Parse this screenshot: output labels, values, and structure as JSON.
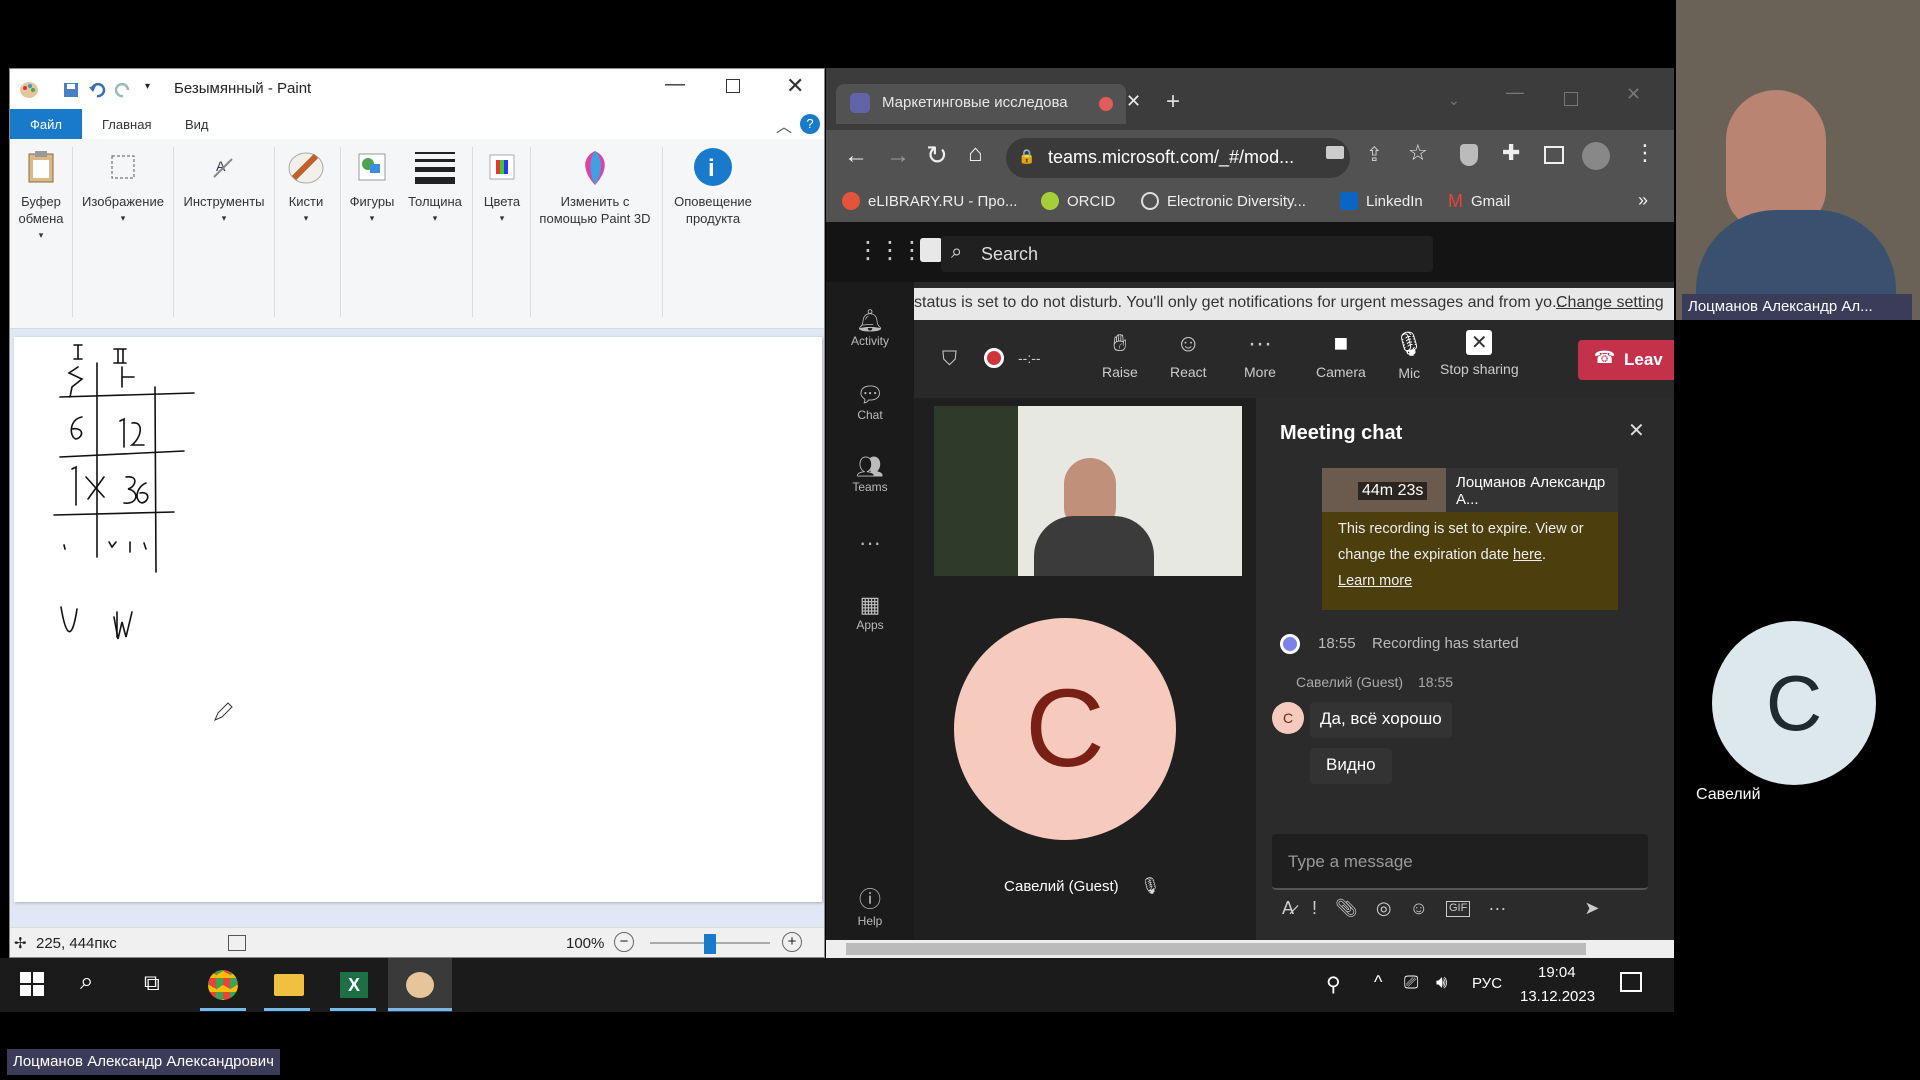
{
  "paint": {
    "title": "Безымянный - Paint",
    "menu": {
      "file": "Файл",
      "home": "Главная",
      "view": "Вид"
    },
    "ribbon": {
      "clipboard": "Буфер обмена",
      "image": "Изображение",
      "tools": "Инструменты",
      "brushes": "Кисти",
      "shapes": "Фигуры",
      "thickness": "Толщина",
      "colors": "Цвета",
      "paint3d": "Изменить с помощью Paint 3D",
      "notification": "Оповещение продукта"
    },
    "status": {
      "coords": "225, 444пкс",
      "zoom": "100%"
    },
    "zoom_level": 0.5
  },
  "browser": {
    "tab_title": "Маркетинговые исследова",
    "url": "teams.microsoft.com/_#/mod...",
    "bookmarks": [
      "eLIBRARY.RU - Про...",
      "ORCID",
      "Electronic Diversity...",
      "LinkedIn",
      "Gmail"
    ],
    "more_bookmarks": "»"
  },
  "teams": {
    "search_placeholder": "Search",
    "rail": {
      "activity": "Activity",
      "chat": "Chat",
      "teams": "Teams",
      "more": "···",
      "apps": "Apps",
      "help": "Help"
    },
    "banner": {
      "text": "status is set to do not disturb. You'll only get notifications for urgent messages and from yo...",
      "link": "Change setting"
    },
    "controls": {
      "timer": "--:--",
      "raise": "Raise",
      "react": "React",
      "more": "More",
      "camera": "Camera",
      "mic": "Mic",
      "stop_sharing": "Stop sharing",
      "leave": "Leav"
    },
    "stage": {
      "avatar_letter": "С",
      "participant": "Савелий (Guest)"
    },
    "chat": {
      "title": "Meeting chat",
      "recording_duration": "44m 23s",
      "recording_owner": "Лоцманов Александр А...",
      "expire_text_1": "This recording is set to expire. View or",
      "expire_text_2": "change the expiration date",
      "expire_link_here": "here",
      "expire_period": ".",
      "learn_more": "Learn more",
      "rec_time": "18:55",
      "rec_text": "Recording has started",
      "sender": "Савелий (Guest)",
      "sender_time": "18:55",
      "msg1": "Да, всё хорошо",
      "msg2": "Видно",
      "avatar_letter": "С",
      "input_placeholder": "Type a message"
    }
  },
  "side": {
    "video1_name": "Лоцманов Александр Ал...",
    "video2_letter": "С",
    "video2_name": "Савелий"
  },
  "taskbar": {
    "language": "РУС",
    "time": "19:04",
    "date": "13.12.2023"
  },
  "bottom_name": "Лоцманов Александр Александрович",
  "colors": {
    "teams_accent": "#7b83eb",
    "leave": "#c4314b",
    "paint_blue": "#1979ca"
  }
}
